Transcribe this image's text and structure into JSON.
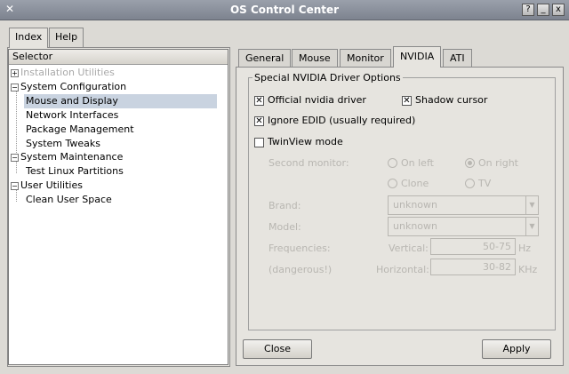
{
  "window": {
    "title": "OS Control Center",
    "app_icon": "x-cursor-icon",
    "controls": [
      "?",
      "_",
      "x"
    ]
  },
  "left_tabs": [
    {
      "label": "Index",
      "active": true
    },
    {
      "label": "Help",
      "active": false
    }
  ],
  "tree": {
    "header": "Selector",
    "items": [
      {
        "label": "Installation Utilities",
        "level": 0,
        "expander": "+",
        "disabled": true
      },
      {
        "label": "System Configuration",
        "level": 0,
        "expander": "-",
        "disabled": false
      },
      {
        "label": "Mouse and Display",
        "level": 1,
        "selected": true
      },
      {
        "label": "Network Interfaces",
        "level": 1
      },
      {
        "label": "Package Management",
        "level": 1
      },
      {
        "label": "System Tweaks",
        "level": 1
      },
      {
        "label": "System Maintenance",
        "level": 0,
        "expander": "-"
      },
      {
        "label": "Test Linux Partitions",
        "level": 1
      },
      {
        "label": "User Utilities",
        "level": 0,
        "expander": "-"
      },
      {
        "label": "Clean User Space",
        "level": 1
      }
    ]
  },
  "right_tabs": [
    {
      "label": "General",
      "active": false
    },
    {
      "label": "Mouse",
      "active": false
    },
    {
      "label": "Monitor",
      "active": false
    },
    {
      "label": "NVIDIA",
      "active": true
    },
    {
      "label": "ATI",
      "active": false
    }
  ],
  "nvidia": {
    "group_title": "Special NVIDIA Driver Options",
    "official_driver": {
      "label": "Official nvidia driver",
      "checked": true
    },
    "shadow_cursor": {
      "label": "Shadow cursor",
      "checked": true
    },
    "ignore_edid": {
      "label": "Ignore EDID (usually required)",
      "checked": true
    },
    "twinview": {
      "label": "TwinView mode",
      "checked": false
    },
    "second_monitor_label": "Second monitor:",
    "radio_on_left": "On left",
    "radio_on_right": "On right",
    "radio_clone": "Clone",
    "radio_tv": "TV",
    "brand_label": "Brand:",
    "brand_value": "unknown",
    "model_label": "Model:",
    "model_value": "unknown",
    "frequencies_label": "Frequencies:",
    "dangerous_label": "(dangerous!)",
    "vertical_label": "Vertical:",
    "vertical_value": "50-75",
    "vertical_unit": "Hz",
    "horizontal_label": "Horizontal:",
    "horizontal_value": "30-82",
    "horizontal_unit": "KHz"
  },
  "buttons": {
    "close": "Close",
    "apply": "Apply"
  }
}
